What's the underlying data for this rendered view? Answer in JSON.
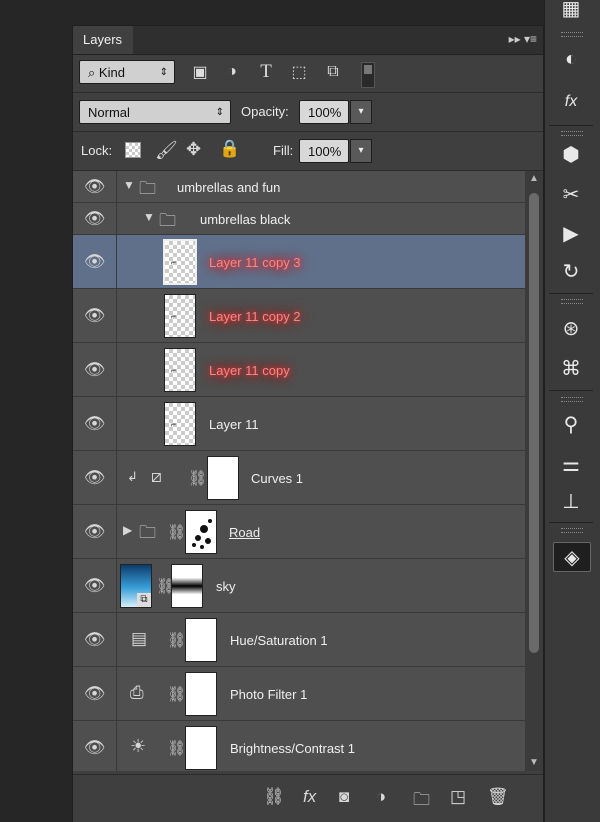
{
  "panel": {
    "tab_label": "Layers",
    "menu_glyph": "▸▸ ▾≡"
  },
  "filter_bar": {
    "kind_label": "Kind",
    "search_icon": "search-icon",
    "filter_icons": [
      "image-filter-icon",
      "adjustment-filter-icon",
      "type-filter-icon",
      "shape-filter-icon",
      "smart-object-filter-icon"
    ]
  },
  "blend_row": {
    "blend_mode": "Normal",
    "opacity_label": "Opacity:",
    "opacity_value": "100%"
  },
  "lock_row": {
    "lock_label": "Lock:",
    "fill_label": "Fill:",
    "fill_value": "100%"
  },
  "layers": [
    {
      "name": "umbrellas and fun",
      "type": "group",
      "expanded": true,
      "indent": 0
    },
    {
      "name": "umbrellas black",
      "type": "group",
      "expanded": true,
      "indent": 1
    },
    {
      "name": "Layer 11 copy 3",
      "type": "pixel",
      "selected": true,
      "highlight": "red-glow"
    },
    {
      "name": "Layer 11 copy 2",
      "type": "pixel",
      "highlight": "red-glow"
    },
    {
      "name": "Layer 11 copy",
      "type": "pixel",
      "highlight": "red-glow"
    },
    {
      "name": "Layer 11",
      "type": "pixel"
    },
    {
      "name": "Curves 1",
      "type": "adjustment",
      "adjustment": "curves",
      "clipped": true
    },
    {
      "name": "Road",
      "type": "group",
      "expanded": false,
      "masked": true
    },
    {
      "name": "sky",
      "type": "smart-object",
      "masked": true
    },
    {
      "name": "Hue/Saturation 1",
      "type": "adjustment",
      "adjustment": "hue-saturation"
    },
    {
      "name": "Photo Filter 1",
      "type": "adjustment",
      "adjustment": "photo-filter"
    },
    {
      "name": "Brightness/Contrast 1",
      "type": "adjustment",
      "adjustment": "brightness-contrast"
    }
  ],
  "bottom_bar": {
    "icons": [
      "link-layers-icon",
      "fx-icon",
      "add-mask-icon",
      "new-adjustment-icon",
      "new-group-icon",
      "new-layer-icon",
      "delete-layer-icon"
    ]
  },
  "right_strip": {
    "icons": [
      "grid-icon",
      "color-icon",
      "styles-icon",
      "3d-icon",
      "tools-icon",
      "play-icon",
      "history-icon",
      "channels-icon",
      "paths-icon",
      "brush-presets-icon",
      "adjust-icon",
      "clone-icon",
      "layers-icon"
    ]
  },
  "colors": {
    "selected_row": "#60708a",
    "glow": "#e33333",
    "panel_bg": "#3f3f3f"
  }
}
